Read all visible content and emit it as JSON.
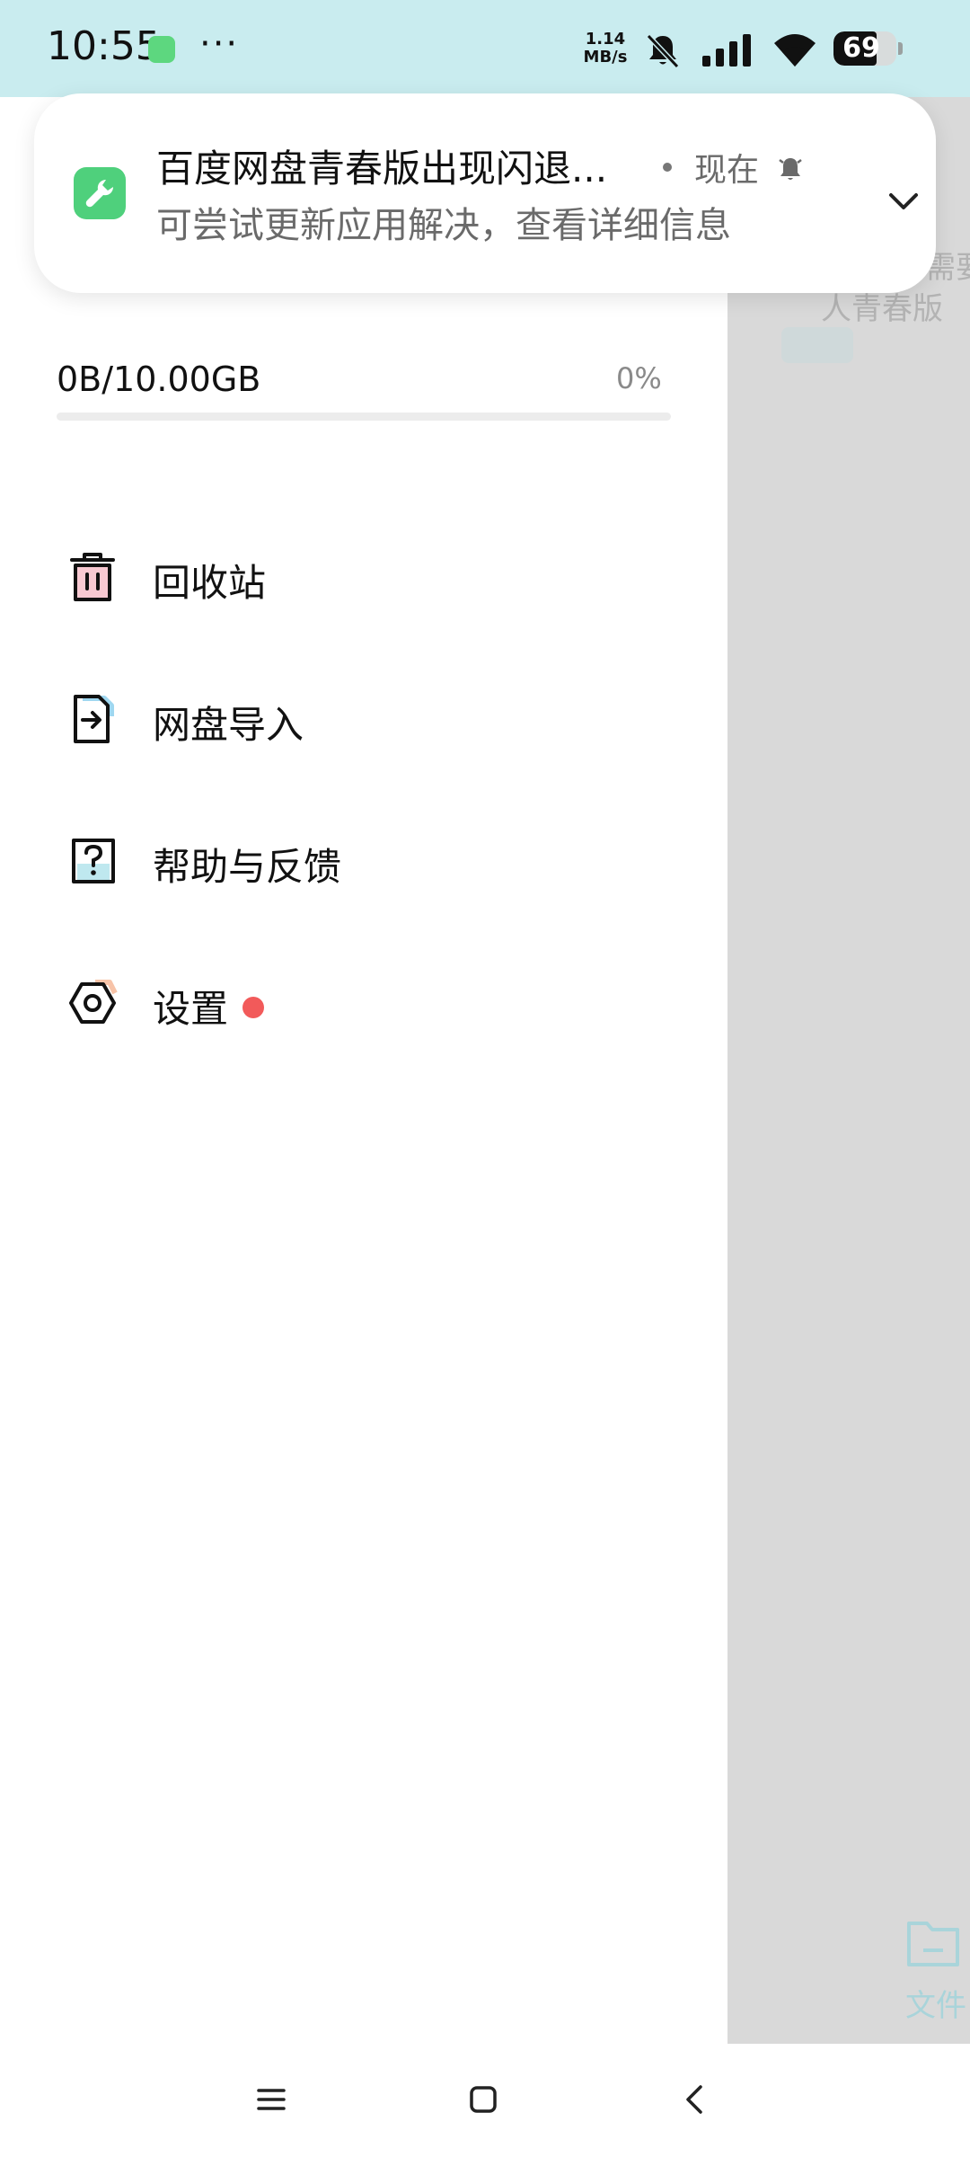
{
  "status_bar": {
    "time": "10:55",
    "overflow": "···",
    "net_speed_value": "1.14",
    "net_speed_unit": "MB/s",
    "battery": "69",
    "battery_level_percent": 69,
    "background_color": "#c9ecef"
  },
  "notification": {
    "title": "百度网盘青春版出现闪退...",
    "time": "现在",
    "body": "可尝试更新应用解决，查看详细信息",
    "icon": "wrench-icon",
    "icon_color": "#4fd07c"
  },
  "storage": {
    "usage_text": "0B/10.00GB",
    "percent_text": "0%",
    "percent_value": 0
  },
  "menu": [
    {
      "label": "回收站",
      "icon": "trash-icon"
    },
    {
      "label": "网盘导入",
      "icon": "file-import-icon"
    },
    {
      "label": "帮助与反馈",
      "icon": "help-icon"
    },
    {
      "label": "设置",
      "icon": "settings-icon",
      "badge": true,
      "badge_color": "#f25a5a"
    }
  ],
  "overlay": {
    "line1": "需要",
    "line2": "人青春版",
    "file_tab_label": "文件"
  },
  "nav_bar": {
    "buttons": [
      "menu-icon",
      "home-icon",
      "back-icon"
    ]
  }
}
